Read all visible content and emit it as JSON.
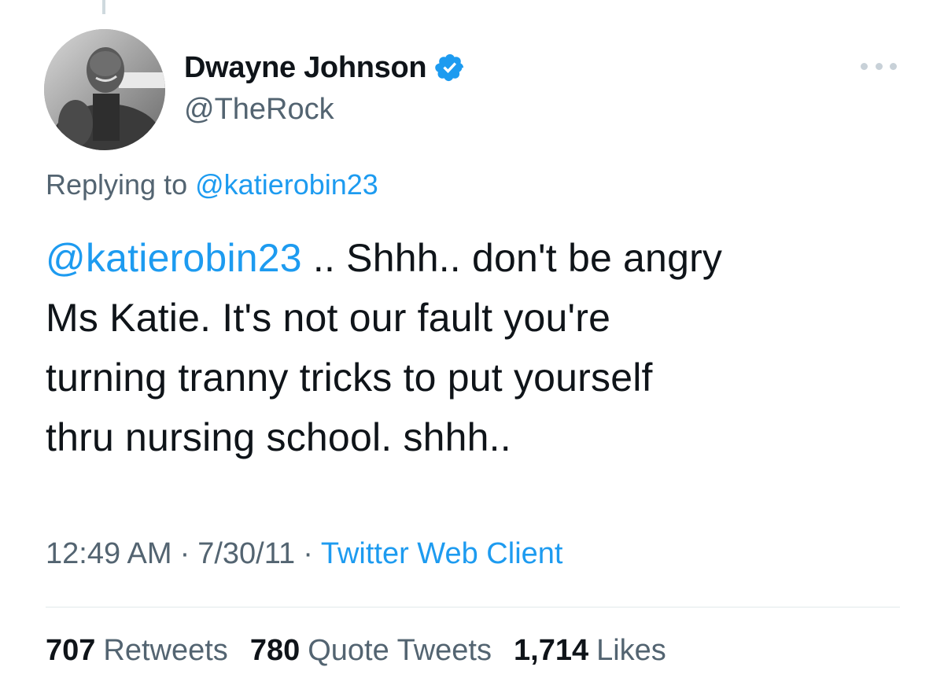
{
  "tweet": {
    "display_name": "Dwayne Johnson",
    "handle": "@TheRock",
    "verified": true,
    "replying_prefix": "Replying to",
    "replying_to": "@katierobin23",
    "text_mention": "@katierobin23",
    "text_line1_rest": " .. Shhh.. don't be angry",
    "text_line2": "Ms Katie. It's not our fault you're",
    "text_line3": "turning tranny tricks to put yourself",
    "text_line4": "thru nursing school. shhh..",
    "time": "12:49 AM",
    "date": "7/30/11",
    "source": "Twitter Web Client",
    "separator": "·"
  },
  "stats": [
    {
      "count": "707",
      "label": "Retweets"
    },
    {
      "count": "780",
      "label": "Quote Tweets"
    },
    {
      "count": "1,714",
      "label": "Likes"
    }
  ],
  "icons": {
    "verified": "verified-badge-icon",
    "more": "more-options-icon"
  },
  "colors": {
    "accent": "#1d9bf0",
    "secondary_text": "#536471",
    "primary_text": "#0f1419"
  }
}
